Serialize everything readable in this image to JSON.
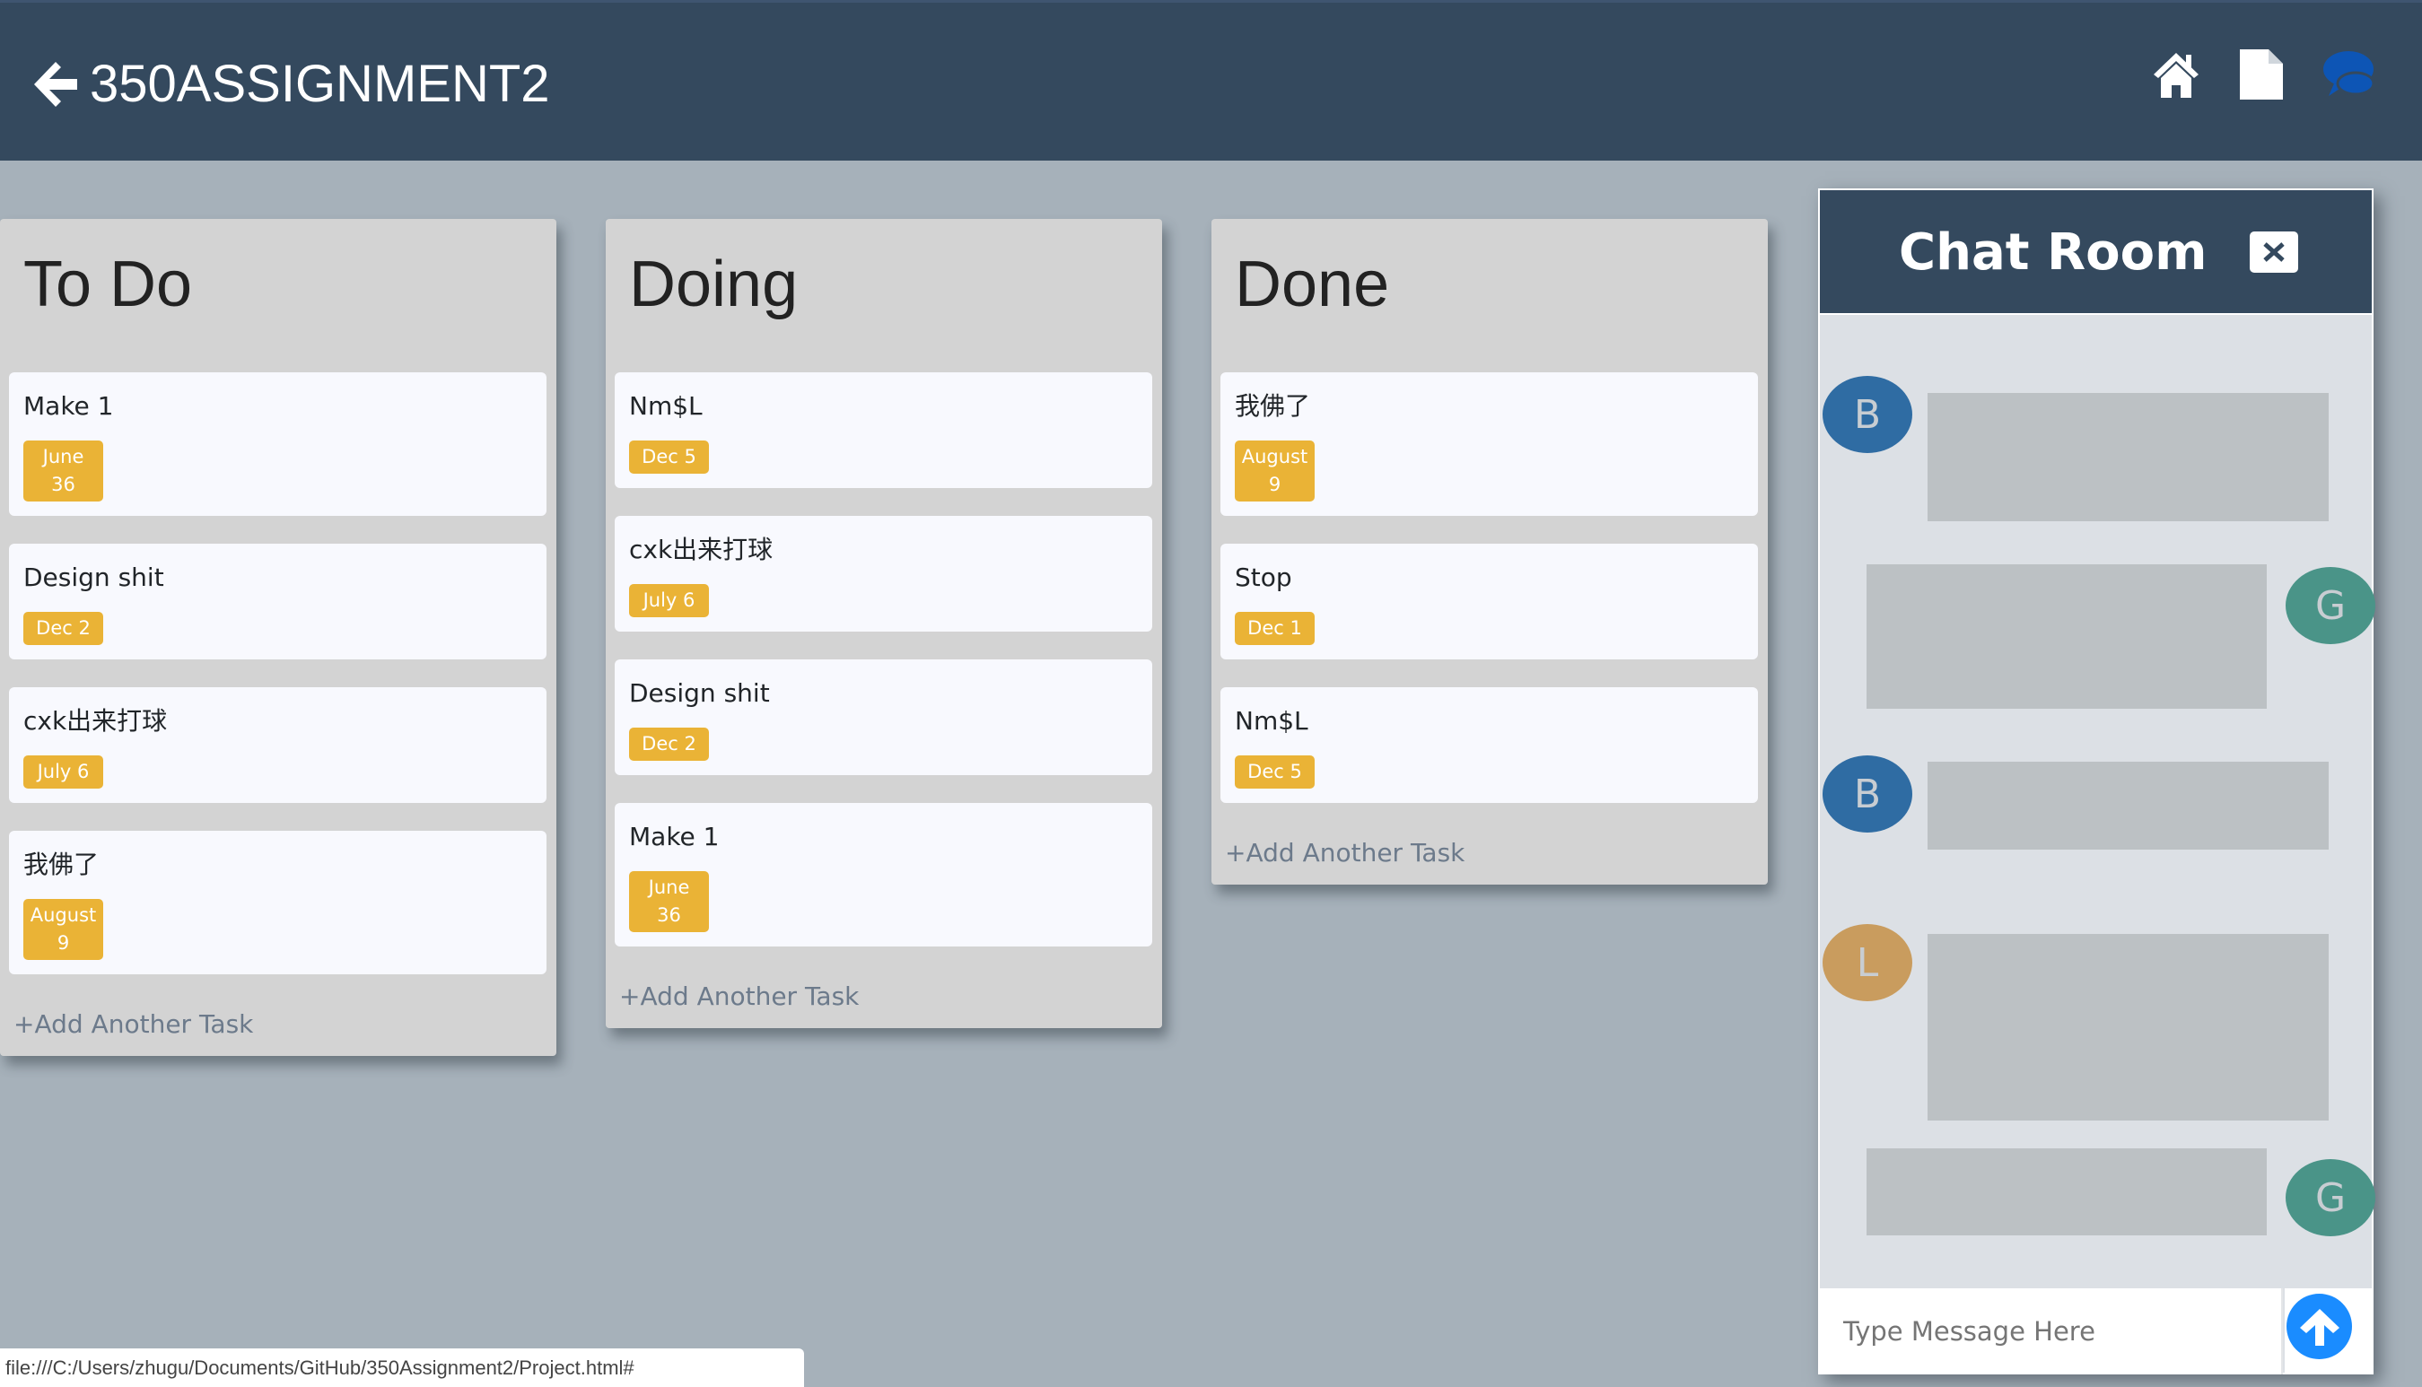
{
  "header": {
    "title": "350ASSIGNMENT2",
    "icons": [
      "back-arrow-icon",
      "home-icon",
      "file-icon",
      "chat-icon"
    ]
  },
  "columns": [
    {
      "title": "To Do",
      "add_label": "+Add Another Task",
      "cards": [
        {
          "title": "Make 1",
          "date": "June 36"
        },
        {
          "title": "Design shit",
          "date": "Dec 2"
        },
        {
          "title": "cxk出来打球",
          "date": "July 6"
        },
        {
          "title": "我佛了",
          "date": "August 9"
        }
      ]
    },
    {
      "title": "Doing",
      "add_label": "+Add Another Task",
      "cards": [
        {
          "title": "Nm$L",
          "date": "Dec 5"
        },
        {
          "title": "cxk出来打球",
          "date": "July 6"
        },
        {
          "title": "Design shit",
          "date": "Dec 2"
        },
        {
          "title": "Make 1",
          "date": "June 36"
        }
      ]
    },
    {
      "title": "Done",
      "add_label": "+Add Another Task",
      "cards": [
        {
          "title": "我佛了",
          "date": "August 9"
        },
        {
          "title": "Stop",
          "date": "Dec 1"
        },
        {
          "title": "Nm$L",
          "date": "Dec 5"
        }
      ]
    }
  ],
  "chat": {
    "title": "Chat Room",
    "messages": [
      {
        "initial": "B",
        "side": "left"
      },
      {
        "initial": "G",
        "side": "right"
      },
      {
        "initial": "B",
        "side": "left"
      },
      {
        "initial": "L",
        "side": "left"
      },
      {
        "initial": "G",
        "side": "right"
      }
    ],
    "input_placeholder": "Type Message Here"
  },
  "colors": {
    "header": "#34495e",
    "badge": "#eab336",
    "avatar_b": "#2f6ca3",
    "avatar_g": "#4a9488",
    "avatar_l": "#c99c5e",
    "send": "#1a8cff"
  },
  "status_bar": "file:///C:/Users/zhugu/Documents/GitHub/350Assignment2/Project.html#"
}
